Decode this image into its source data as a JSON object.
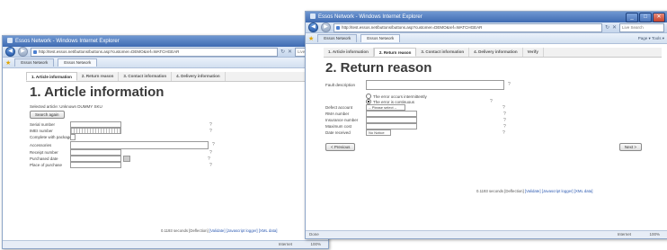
{
  "window_title": "Essos Network - Windows Internet Explorer",
  "address_url": "http://test.essos.net/buttons/buttons.asp?customer=DEMO&ref=WATCHGEAR",
  "search_placeholder": "Live Search",
  "favorites_tab": "Essos Network",
  "browser_tab": "Essos Network",
  "toolbar_right": "Page ▾  Tools ▾",
  "steps": [
    "1. Article information",
    "2. Return reason",
    "3. Contact information",
    "4. Delivery information",
    "Verify"
  ],
  "form1": {
    "title": "1. Article information",
    "selected_text": "Selected article: Unknown DUMMY SKU",
    "search_again": "Search again",
    "fields": [
      "Serial number",
      "IMEI number",
      "Complete with package",
      "Accessories",
      "Receipt number",
      "Purchased date",
      "Place of purchase"
    ]
  },
  "form2": {
    "title": "2. Return reason",
    "fault_label": "Fault description",
    "radio1": "The error occurs intermittently",
    "radio2": "The error is continuous",
    "fields": [
      "Defect account",
      "RMA number",
      "Insurance number",
      "Maximum cost",
      "Date received"
    ],
    "select_placeholder": "-- Please select --",
    "date_value": "No Notice",
    "prev_button": "< Previous",
    "next_button": "Next >"
  },
  "footer_text": "0.1193 seconds [Deflection]",
  "footer_links": [
    "[Validate]",
    "[Javascript logger]",
    "[XML data]"
  ],
  "status_left": "Done",
  "status_zone": "Internet",
  "status_zoom": "100%"
}
